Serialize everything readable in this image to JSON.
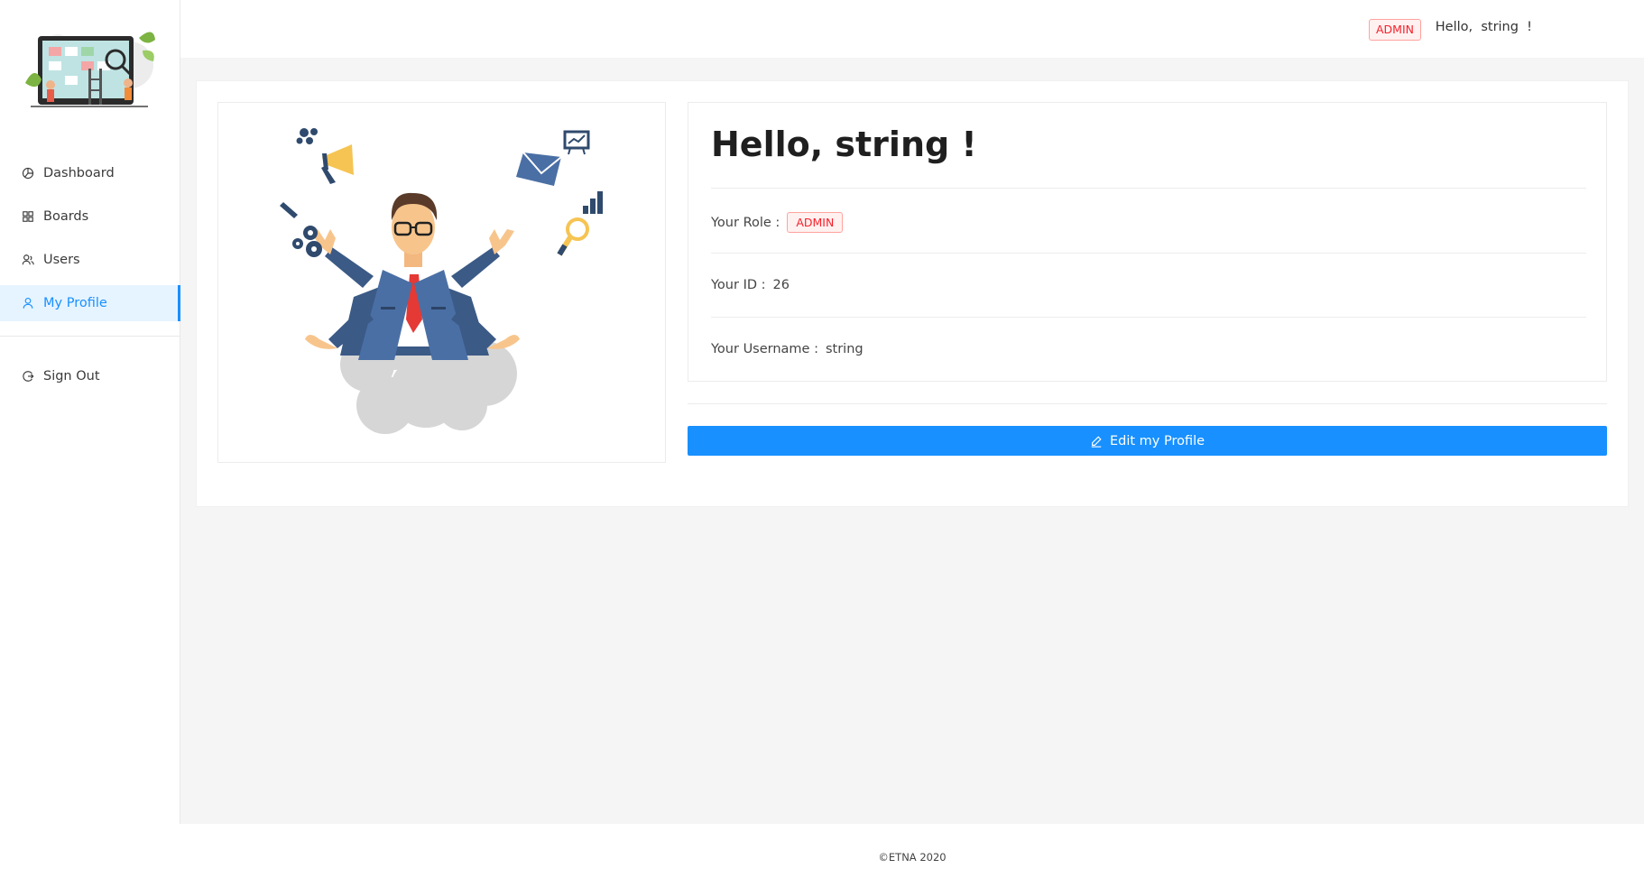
{
  "sidebar": {
    "logo_icon": "kanban-board-illustration",
    "items": [
      {
        "label": "Dashboard",
        "icon": "pie-chart-icon",
        "active": false
      },
      {
        "label": "Boards",
        "icon": "appstore-icon",
        "active": false
      },
      {
        "label": "Users",
        "icon": "users-icon",
        "active": false
      },
      {
        "label": "My Profile",
        "icon": "user-icon",
        "active": true
      }
    ],
    "signout": {
      "label": "Sign Out",
      "icon": "logout-icon"
    }
  },
  "header": {
    "greeting": "Hello,  string  !",
    "role_tag": "ADMIN"
  },
  "profile": {
    "illustration_icon": "multitasking-businessman-illustration",
    "title": "Hello, string !",
    "role_label": "Your Role :",
    "role_value": "ADMIN",
    "id_label": "Your ID :",
    "id_value": "26",
    "username_label": "Your Username :",
    "username_value": "string",
    "edit_button": "Edit my Profile",
    "edit_icon": "edit-icon"
  },
  "footer": {
    "text": "©ETNA 2020"
  },
  "colors": {
    "primary": "#1890ff",
    "admin_tag_text": "#f5222d",
    "admin_tag_border": "#ffa39e",
    "admin_tag_bg": "#fff1f0",
    "content_bg": "#f5f5f5"
  }
}
